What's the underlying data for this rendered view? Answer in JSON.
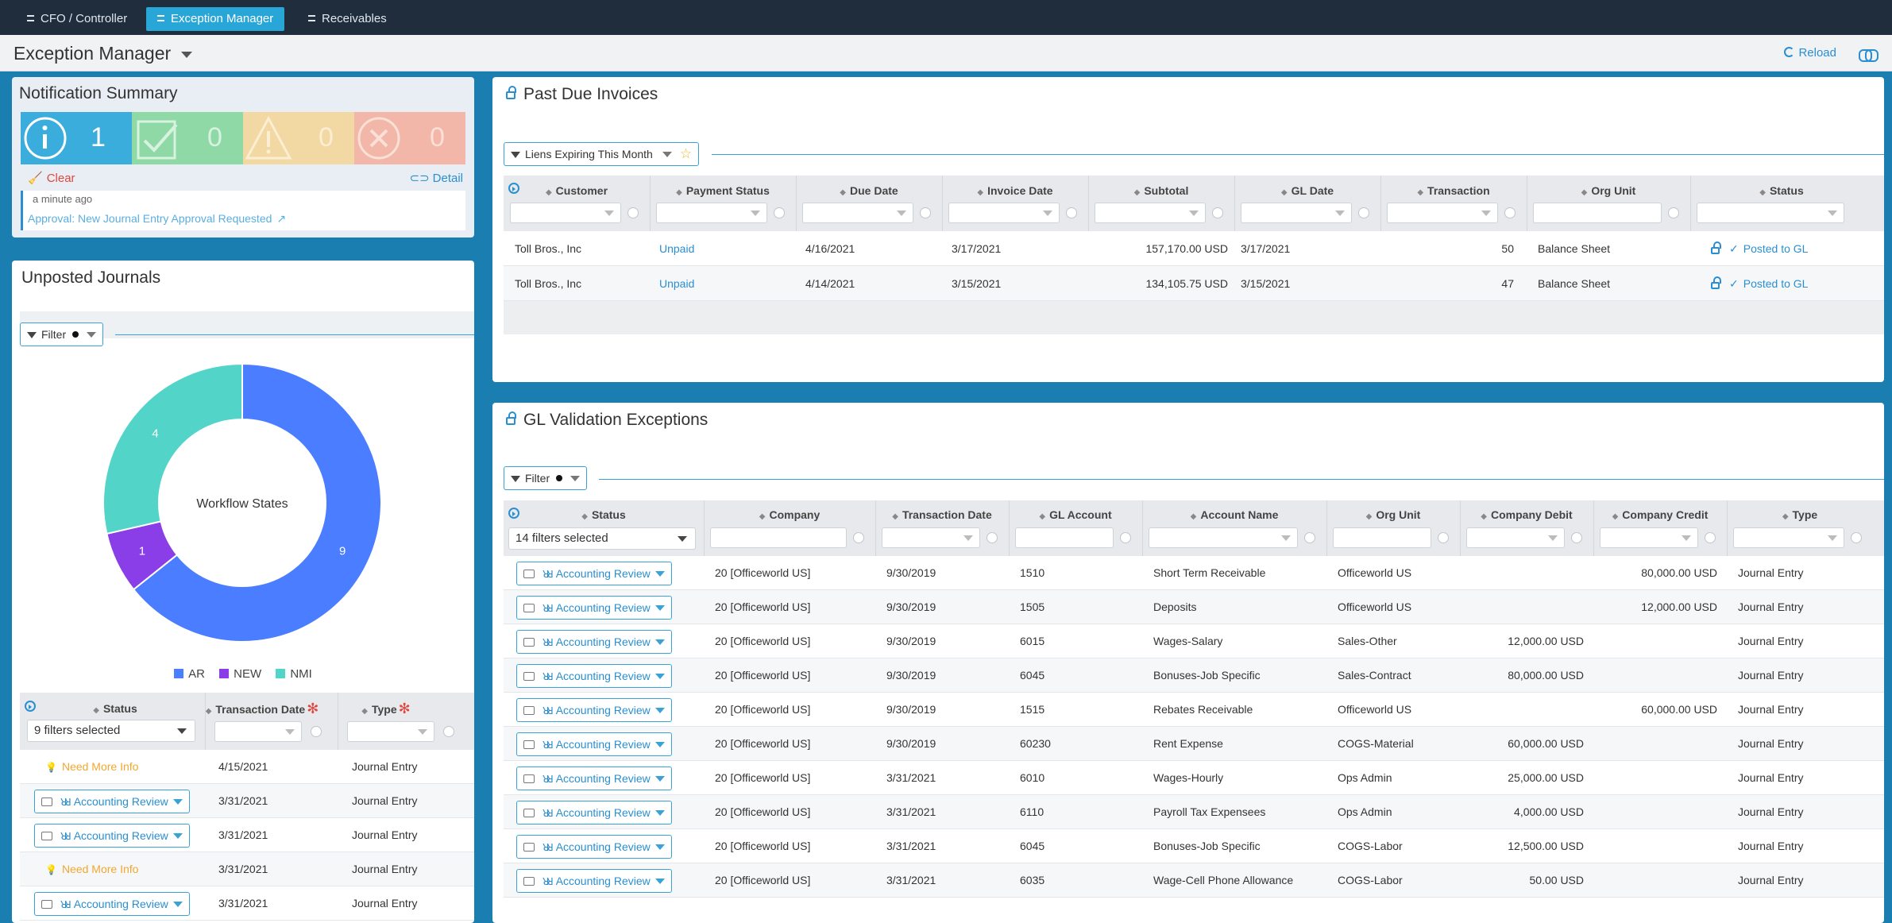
{
  "tabs": [
    {
      "label": "CFO / Controller"
    },
    {
      "label": "Exception Manager"
    },
    {
      "label": "Receivables"
    }
  ],
  "header": {
    "title": "Exception Manager",
    "reload_label": "Reload"
  },
  "icons": [
    "grid-icon",
    "chevron-down-icon",
    "reload-icon",
    "link-icon",
    "lock-icon",
    "filter-icon",
    "star-icon",
    "column-picker-icon",
    "sort-icon",
    "chat-icon",
    "people-icon",
    "lightbulb-icon",
    "checkmark-icon",
    "broom-icon",
    "external-link-icon",
    "info-icon",
    "warning-icon",
    "x-circle-icon"
  ],
  "colors": {
    "accent": "#2a8fd0",
    "topbar": "#1f2d3d",
    "tab_active": "#28a6d8",
    "background": "#1a7fb0",
    "ar": "#4a7dff",
    "new": "#8a3ee8",
    "nmi": "#52d5c8",
    "warning": "#f0a830"
  },
  "notification": {
    "title": "Notification Summary",
    "tiles": [
      {
        "kind": "info",
        "count": "1",
        "color": "#3aaddc"
      },
      {
        "kind": "success",
        "count": "0",
        "color": "#8ed9a6"
      },
      {
        "kind": "warning",
        "count": "0",
        "color": "#f2d8a2"
      },
      {
        "kind": "error",
        "count": "0",
        "color": "#f2b7a8"
      }
    ],
    "clear_label": "Clear",
    "detail_label": "Detail",
    "time": "a minute ago",
    "message": "Approval: New Journal Entry Approval Requested"
  },
  "unposted": {
    "title": "Unposted Journals",
    "filter_label": "Filter",
    "chart_data": {
      "type": "pie",
      "center_label": "Workflow States",
      "series": [
        {
          "name": "AR",
          "value": 9,
          "color": "#4a7dff"
        },
        {
          "name": "NEW",
          "value": 1,
          "color": "#8a3ee8"
        },
        {
          "name": "NMI",
          "value": 4,
          "color": "#52d5c8"
        }
      ],
      "legend_position": "bottom"
    },
    "table": {
      "headers": [
        "Status",
        "Transaction Date",
        "Type"
      ],
      "status_filter": "9 filters selected",
      "rows": [
        {
          "status": "Need More Info",
          "kind": "nmi",
          "date": "4/15/2021",
          "type": "Journal Entry"
        },
        {
          "status": "Accounting Review",
          "kind": "ar",
          "date": "3/31/2021",
          "type": "Journal Entry"
        },
        {
          "status": "Accounting Review",
          "kind": "ar",
          "date": "3/31/2021",
          "type": "Journal Entry"
        },
        {
          "status": "Need More Info",
          "kind": "nmi",
          "date": "3/31/2021",
          "type": "Journal Entry"
        },
        {
          "status": "Accounting Review",
          "kind": "ar",
          "date": "3/31/2021",
          "type": "Journal Entry"
        }
      ]
    }
  },
  "past_due": {
    "title": "Past Due Invoices",
    "filter_label": "Liens Expiring This Month",
    "headers": [
      "Customer",
      "Payment Status",
      "Due Date",
      "Invoice Date",
      "Subtotal",
      "GL Date",
      "Transaction",
      "Org Unit",
      "Status"
    ],
    "rows": [
      {
        "customer": "Toll Bros., Inc",
        "payment_status": "Unpaid",
        "due_date": "4/16/2021",
        "invoice_date": "3/17/2021",
        "subtotal": "157,170.00 USD",
        "gl_date": "3/17/2021",
        "transaction": "50",
        "org_unit": "Balance Sheet",
        "status": "Posted to GL"
      },
      {
        "customer": "Toll Bros., Inc",
        "payment_status": "Unpaid",
        "due_date": "4/14/2021",
        "invoice_date": "3/15/2021",
        "subtotal": "134,105.75 USD",
        "gl_date": "3/15/2021",
        "transaction": "47",
        "org_unit": "Balance Sheet",
        "status": "Posted to GL"
      }
    ]
  },
  "gl": {
    "title": "GL Validation Exceptions",
    "filter_label": "Filter",
    "status_filter": "14 filters selected",
    "headers": [
      "Status",
      "Company",
      "Transaction Date",
      "GL Account",
      "Account Name",
      "Org Unit",
      "Company Debit",
      "Company Credit",
      "Type"
    ],
    "rows": [
      {
        "status": "Accounting Review",
        "company": "20 [Officeworld US]",
        "date": "9/30/2019",
        "account": "1510",
        "name": "Short Term Receivable",
        "org": "Officeworld US",
        "debit": "",
        "credit": "80,000.00 USD",
        "type": "Journal Entry"
      },
      {
        "status": "Accounting Review",
        "company": "20 [Officeworld US]",
        "date": "9/30/2019",
        "account": "1505",
        "name": "Deposits",
        "org": "Officeworld US",
        "debit": "",
        "credit": "12,000.00 USD",
        "type": "Journal Entry"
      },
      {
        "status": "Accounting Review",
        "company": "20 [Officeworld US]",
        "date": "9/30/2019",
        "account": "6015",
        "name": "Wages-Salary",
        "org": "Sales-Other",
        "debit": "12,000.00 USD",
        "credit": "",
        "type": "Journal Entry"
      },
      {
        "status": "Accounting Review",
        "company": "20 [Officeworld US]",
        "date": "9/30/2019",
        "account": "6045",
        "name": "Bonuses-Job Specific",
        "org": "Sales-Contract",
        "debit": "80,000.00 USD",
        "credit": "",
        "type": "Journal Entry"
      },
      {
        "status": "Accounting Review",
        "company": "20 [Officeworld US]",
        "date": "9/30/2019",
        "account": "1515",
        "name": "Rebates Receivable",
        "org": "Officeworld US",
        "debit": "",
        "credit": "60,000.00 USD",
        "type": "Journal Entry"
      },
      {
        "status": "Accounting Review",
        "company": "20 [Officeworld US]",
        "date": "9/30/2019",
        "account": "60230",
        "name": "Rent Expense",
        "org": "COGS-Material",
        "debit": "60,000.00 USD",
        "credit": "",
        "type": "Journal Entry"
      },
      {
        "status": "Accounting Review",
        "company": "20 [Officeworld US]",
        "date": "3/31/2021",
        "account": "6010",
        "name": "Wages-Hourly",
        "org": "Ops Admin",
        "debit": "25,000.00 USD",
        "credit": "",
        "type": "Journal Entry"
      },
      {
        "status": "Accounting Review",
        "company": "20 [Officeworld US]",
        "date": "3/31/2021",
        "account": "6110",
        "name": "Payroll Tax Expensees",
        "org": "Ops Admin",
        "debit": "4,000.00 USD",
        "credit": "",
        "type": "Journal Entry"
      },
      {
        "status": "Accounting Review",
        "company": "20 [Officeworld US]",
        "date": "3/31/2021",
        "account": "6045",
        "name": "Bonuses-Job Specific",
        "org": "COGS-Labor",
        "debit": "12,500.00 USD",
        "credit": "",
        "type": "Journal Entry"
      },
      {
        "status": "Accounting Review",
        "company": "20 [Officeworld US]",
        "date": "3/31/2021",
        "account": "6035",
        "name": "Wage-Cell Phone Allowance",
        "org": "COGS-Labor",
        "debit": "50.00 USD",
        "credit": "",
        "type": "Journal Entry"
      }
    ]
  }
}
